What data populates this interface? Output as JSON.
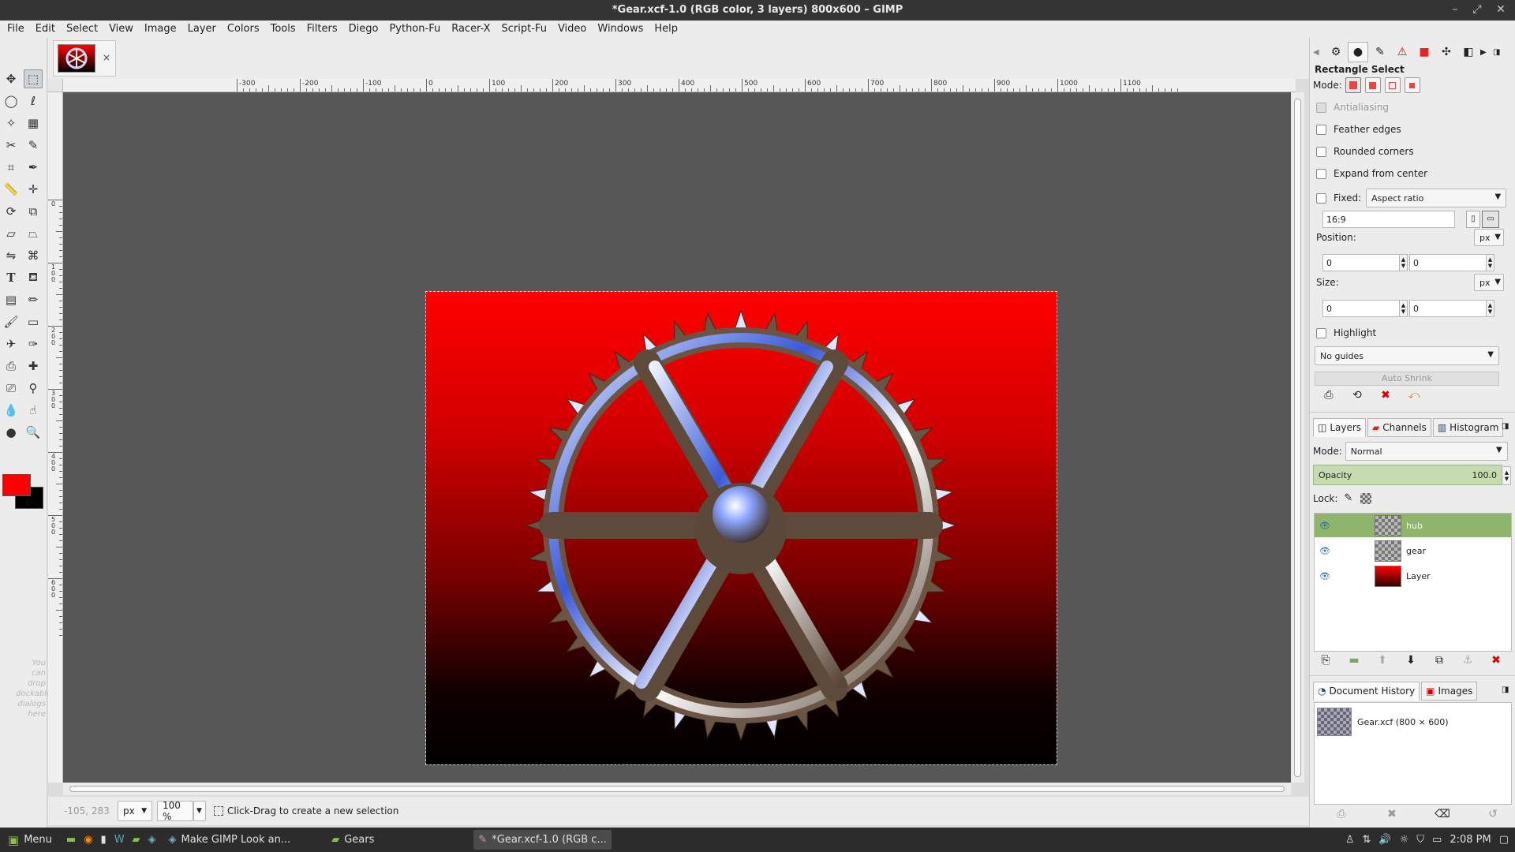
{
  "window": {
    "title": "*Gear.xcf-1.0 (RGB color, 3 layers) 800x600 – GIMP",
    "controls": [
      "–",
      "⤢",
      "✕"
    ]
  },
  "menubar": [
    "File",
    "Edit",
    "Select",
    "View",
    "Image",
    "Layer",
    "Colors",
    "Tools",
    "Filters",
    "Diego",
    "Python-Fu",
    "Racer-X",
    "Script-Fu",
    "Video",
    "Windows",
    "Help"
  ],
  "toolbox": {
    "dock_hint": "You can drop dockable dialogs here",
    "foreground_color": "#ff0000",
    "background_color": "#000000"
  },
  "image_tab": {
    "close_glyph": "×"
  },
  "rulers": {
    "horizontal_labels": [
      "-300",
      "-200",
      "-100",
      "0",
      "100",
      "200",
      "300",
      "400",
      "500",
      "600",
      "700",
      "800",
      "900",
      "1000",
      "1100"
    ],
    "vertical_labels": [
      "0",
      "100",
      "200",
      "300",
      "400",
      "500",
      "600"
    ]
  },
  "status": {
    "pointer_coords": "-105, 283",
    "unit": "px",
    "zoom": "100 %",
    "message": "Click-Drag to create a new selection"
  },
  "tool_options": {
    "title": "Rectangle Select",
    "mode_label": "Mode:",
    "antialiasing": "Antialiasing",
    "feather_edges": "Feather edges",
    "rounded_corners": "Rounded corners",
    "expand_from_center": "Expand from center",
    "fixed_label": "Fixed:",
    "fixed_value": "Aspect ratio",
    "ratio_value": "16:9",
    "position_label": "Position:",
    "position_unit": "px",
    "position_x": "0",
    "position_y": "0",
    "size_label": "Size:",
    "size_unit": "px",
    "size_w": "0",
    "size_h": "0",
    "highlight": "Highlight",
    "guides": "No guides",
    "auto_shrink": "Auto Shrink"
  },
  "layers_panel": {
    "tabs": [
      "Layers",
      "Channels",
      "Histogram"
    ],
    "mode_label": "Mode:",
    "mode_value": "Normal",
    "opacity_label": "Opacity",
    "opacity_value": "100.0",
    "lock_label": "Lock:",
    "layers": [
      {
        "name": "hub",
        "selected": true
      },
      {
        "name": "gear",
        "selected": false
      },
      {
        "name": "Layer",
        "selected": false
      }
    ]
  },
  "history_panel": {
    "tabs": [
      "Document History",
      "Images"
    ],
    "entry": "Gear.xcf (800 × 600)"
  },
  "taskbar": {
    "menu_label": "Menu",
    "tasks": [
      "Make GIMP Look an...",
      "Gears",
      "*Gear.xcf-1.0 (RGB c..."
    ],
    "clock": "2:08 PM"
  }
}
